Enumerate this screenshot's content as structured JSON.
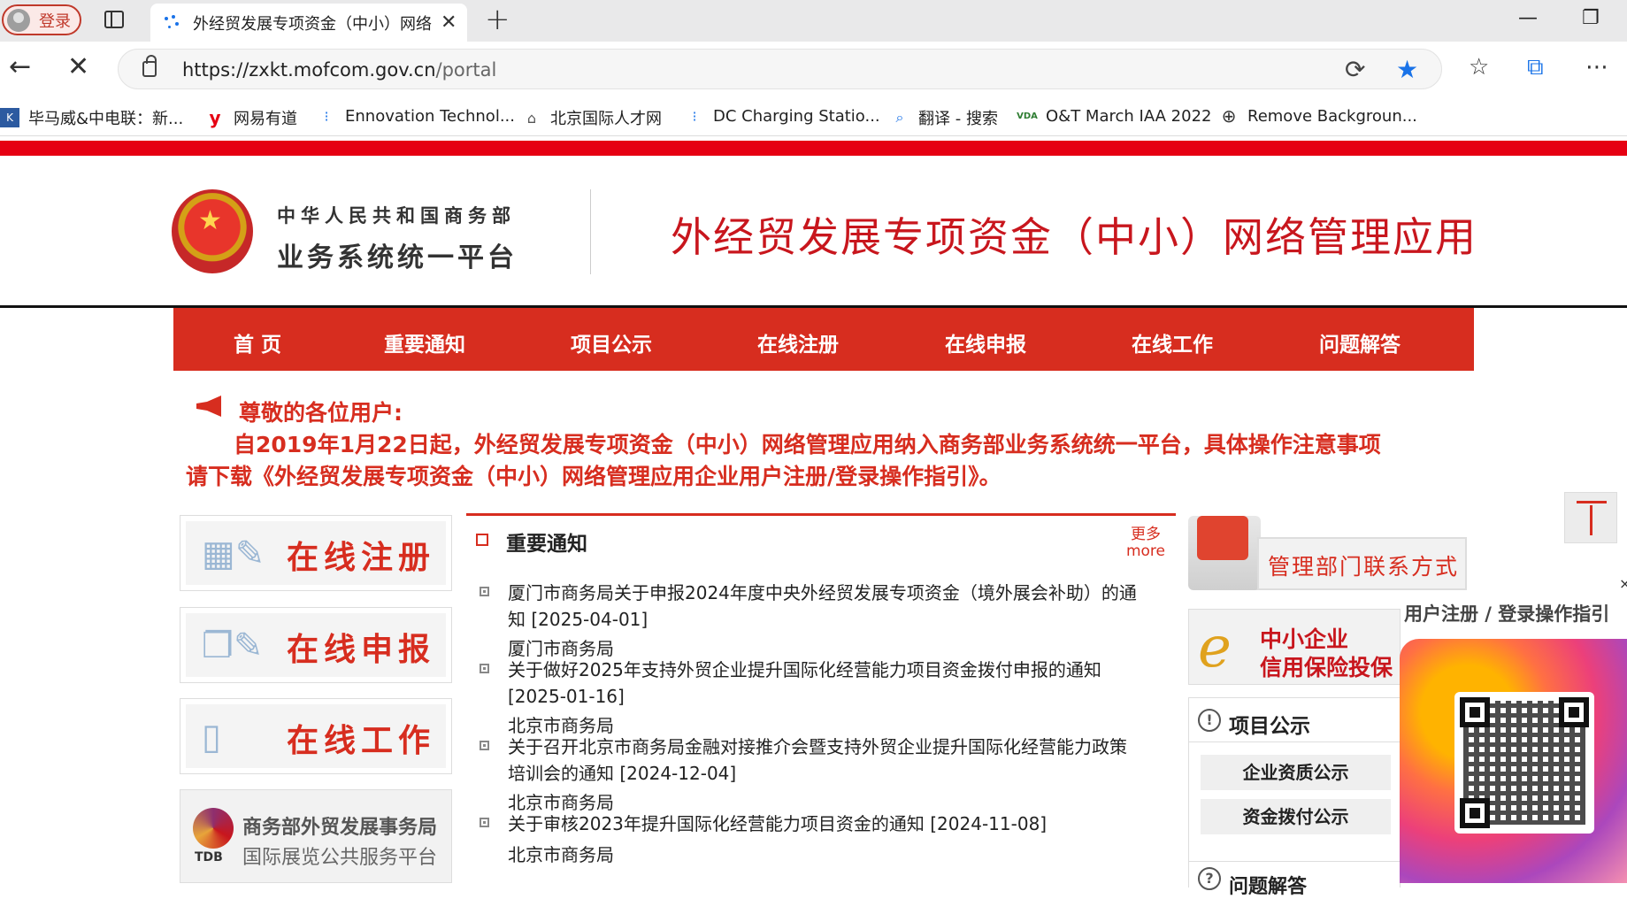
{
  "browser": {
    "profile_label": "登录",
    "tab_title": "外经贸发展专项资金（中小）网络",
    "url_host": "https://zxkt.mofcom.gov.cn",
    "url_path": "/portal",
    "bookmarks": [
      {
        "label": "毕马威&中电联：新...",
        "icon": "kpmg-icon"
      },
      {
        "label": "网易有道",
        "icon": "youdao-icon"
      },
      {
        "label": "Ennovation Technol...",
        "icon": "ennovation-icon"
      },
      {
        "label": "北京国际人才网",
        "icon": "bjrc-icon"
      },
      {
        "label": "DC Charging Statio...",
        "icon": "dc-charging-icon"
      },
      {
        "label": "翻译 - 搜索",
        "icon": "search-icon"
      },
      {
        "label": "O&T March IAA 2022",
        "icon": "vda-icon"
      },
      {
        "label": "Remove Backgroun...",
        "icon": "globe-icon"
      }
    ]
  },
  "header": {
    "ministry_small": "中华人民共和国商务部",
    "ministry_big": "业务系统统一平台",
    "title": "外经贸发展专项资金（中小）网络管理应用"
  },
  "nav": [
    "首 页",
    "重要通知",
    "项目公示",
    "在线注册",
    "在线申报",
    "在线工作",
    "问题解答"
  ],
  "notice": {
    "greeting": "尊敬的各位用户:",
    "line1": "自2019年1月22日起，外经贸发展专项资金（中小）网络管理应用纳入商务部业务系统统一平台，具体操作注意事项",
    "line2": "请下载《外经贸发展专项资金（中小）网络管理应用企业用户注册/登录操作指引》。"
  },
  "left_buttons": [
    "在线注册",
    "在线申报",
    "在线工作"
  ],
  "tdb": {
    "abbr": "TDB",
    "line1": "商务部外贸发展事务局",
    "line2": "国际展览公共服务平台"
  },
  "important": {
    "title": "重要通知",
    "more_cn": "更多",
    "more_en": "more",
    "items": [
      {
        "line1": "厦门市商务局关于申报2024年度中央外经贸发展专项资金（境外展会补助）的通",
        "line2": "知 [2025-04-01]",
        "org": "厦门市商务局"
      },
      {
        "line1": "关于做好2025年支持外贸企业提升国际化经营能力项目资金拨付申报的通知",
        "line2": "[2025-01-16]",
        "org": "北京市商务局"
      },
      {
        "line1": "关于召开北京市商务局金融对接推介会暨支持外贸企业提升国际化经营能力政策",
        "line2": "培训会的通知 [2024-12-04]",
        "org": "北京市商务局"
      },
      {
        "line1": "关于审核2023年提升国际化经营能力项目资金的通知 [2024-11-08]",
        "line2": "",
        "org": "北京市商务局"
      }
    ]
  },
  "right": {
    "contact": "管理部门联系方式",
    "credit_line1": "中小企业",
    "credit_line2": "信用保险投保",
    "projects_title": "项目公示",
    "project_links": [
      "企业资质公示",
      "资金拨付公示"
    ],
    "faq_title": "问题解答"
  },
  "floating": {
    "label": "用户注册 / 登录操作指引",
    "close": "×"
  }
}
